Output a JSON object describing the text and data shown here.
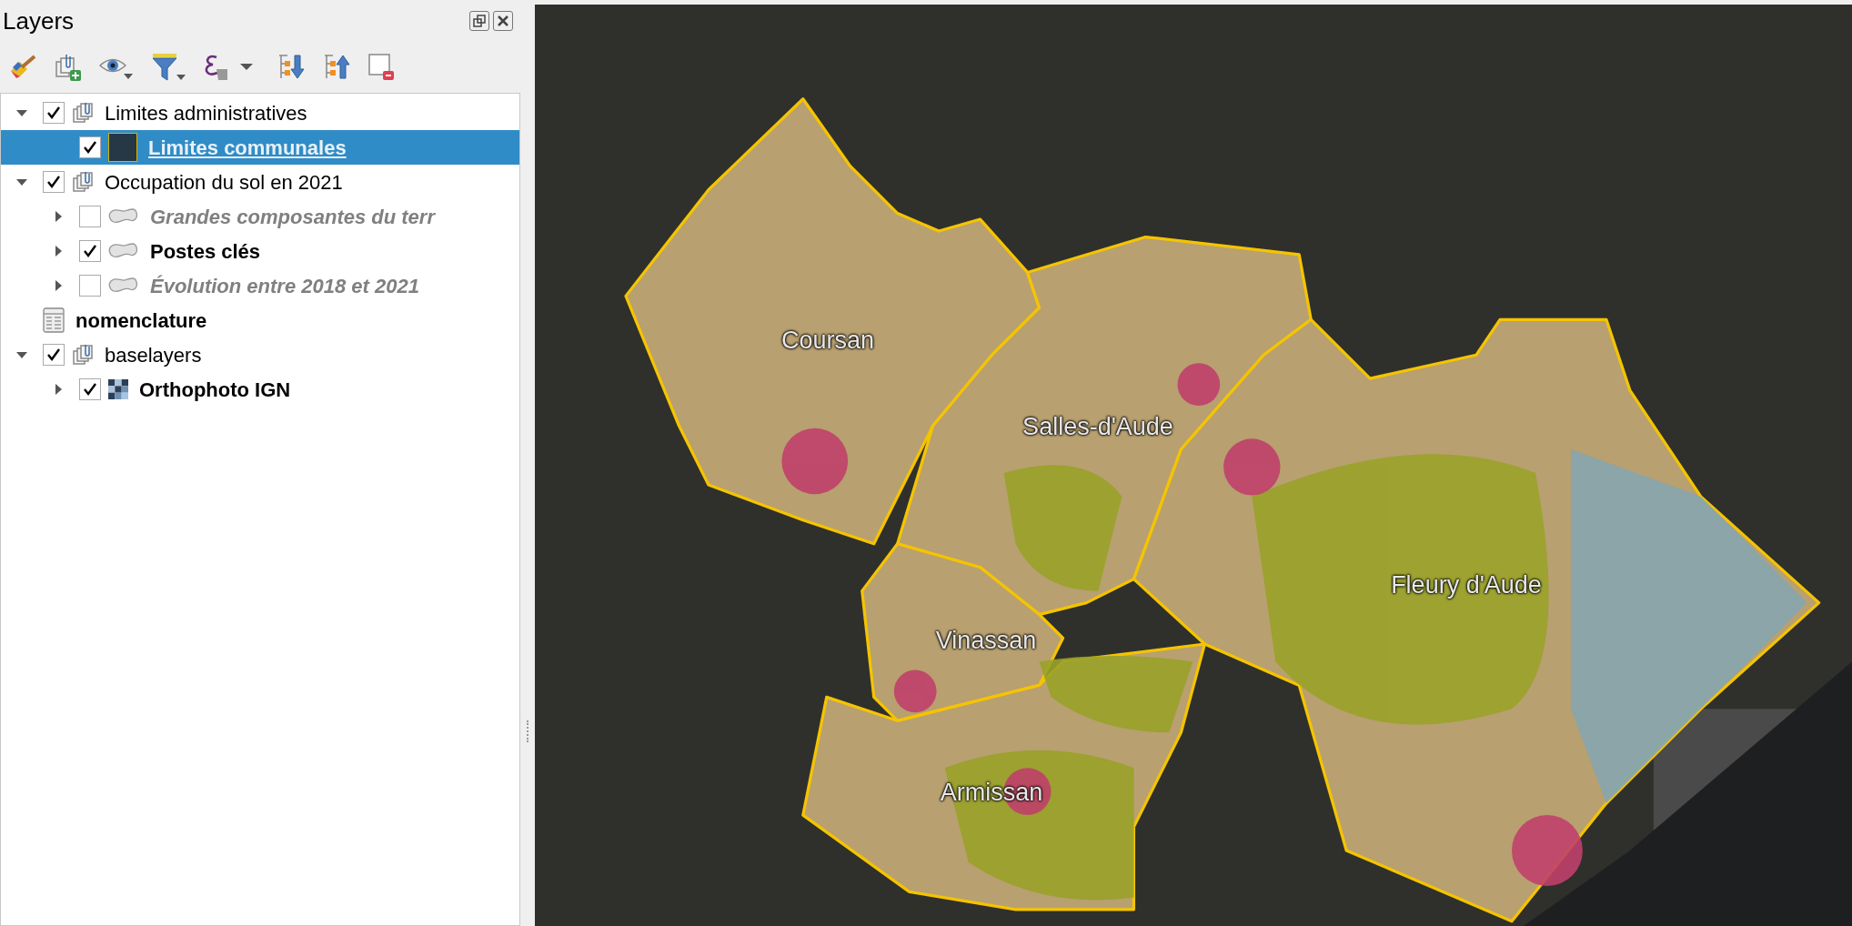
{
  "panel": {
    "title": "Layers"
  },
  "tree": [
    {
      "kind": "group",
      "label": "Limites administratives",
      "checked": true,
      "expanded": true,
      "selected": false,
      "children": [
        {
          "kind": "fill",
          "label": "Limites communales",
          "checked": true,
          "selected": true,
          "color": "#263845"
        }
      ]
    },
    {
      "kind": "group",
      "label": "Occupation du sol en 2021",
      "checked": true,
      "expanded": true,
      "selected": false,
      "children": [
        {
          "kind": "polygon",
          "label": "Grandes composantes du terr",
          "checked": false,
          "expanded": false,
          "selected": false
        },
        {
          "kind": "polygon",
          "label": "Postes clés",
          "checked": true,
          "expanded": false,
          "selected": false
        },
        {
          "kind": "polygon",
          "label": "Évolution entre 2018 et 2021",
          "checked": false,
          "expanded": false,
          "selected": false
        }
      ]
    },
    {
      "kind": "table",
      "label": "nomenclature",
      "selected": false
    },
    {
      "kind": "group",
      "label": "baselayers",
      "checked": true,
      "expanded": true,
      "selected": false,
      "children": [
        {
          "kind": "raster",
          "label": "Orthophoto IGN",
          "checked": true,
          "expanded": false,
          "selected": false
        }
      ]
    }
  ],
  "map": {
    "labels": [
      "Coursan",
      "Salles-d'Aude",
      "Vinassan",
      "Armissan",
      "Fleury d'Aude"
    ]
  }
}
